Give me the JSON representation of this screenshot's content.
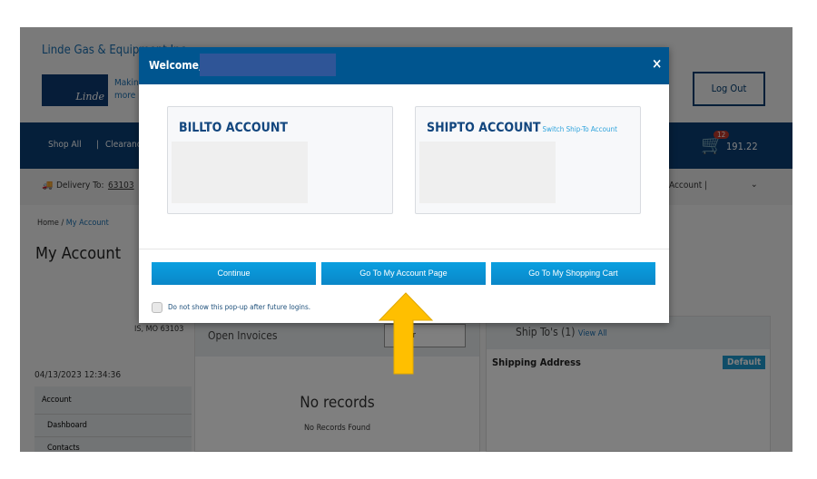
{
  "background": {
    "brand": "Linde Gas & Equipment Inc.",
    "logo_text": "Linde",
    "tagline": [
      "Making our world",
      "more productive"
    ],
    "logout": "Log Out",
    "nav": {
      "shop_all": "Shop All",
      "clearance": "Clearance",
      "cart_count": "12",
      "cart_total": "191.22"
    },
    "delivery": {
      "label": "Delivery To:",
      "zip": "63103",
      "account": "Account |"
    },
    "breadcrumb": {
      "home": "Home",
      "current": "My Account"
    },
    "page_title": "My Account",
    "address_fragment": "IS, MO 63103",
    "last_login": "04/13/2023 12:34:36",
    "sidebar": [
      "Account",
      "Dashboard",
      "Contacts"
    ],
    "invoices": {
      "title": "Open Invoices",
      "currency": "Dollar",
      "empty_title": "No records",
      "empty_sub": "No Records Found"
    },
    "shiptos": {
      "title": "Ship To's (1)",
      "view_all": "View All",
      "shipping_address": "Shipping Address",
      "default": "Default"
    }
  },
  "modal": {
    "welcome": "Welcome,",
    "close": "×",
    "billto_title": "BILLTO ACCOUNT",
    "shipto_title": "SHIPTO ACCOUNT",
    "switch_link": "Switch Ship-To Account",
    "buttons": [
      "Continue",
      "Go To My Account Page",
      "Go To My Shopping Cart"
    ],
    "checkbox_label": "Do not show this pop-up after future logins.",
    "checkbox_checked": false
  },
  "annotation": {
    "arrow_color": "#ffbf00",
    "points_to": "Go To My Account Page"
  }
}
